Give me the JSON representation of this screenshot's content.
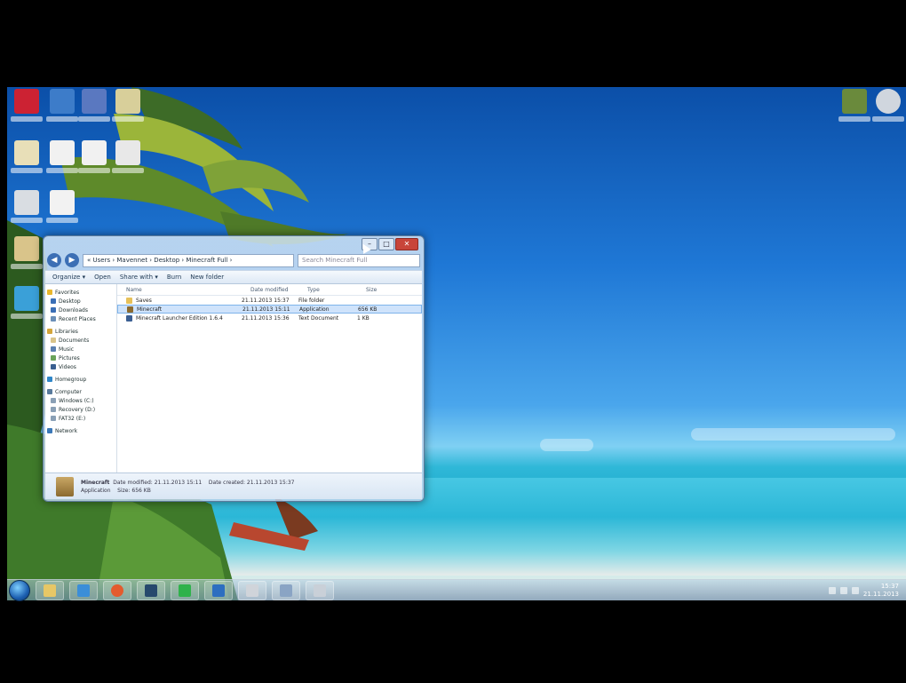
{
  "explorer": {
    "address": "« Users › Mavennet › Desktop › Minecraft Full ›",
    "search_placeholder": "Search Minecraft Full",
    "toolbar": [
      "Organize ▾",
      "Open",
      "Share with ▾",
      "Burn",
      "New folder"
    ],
    "nav": [
      {
        "label": "Favorites",
        "top": true,
        "icon": "star-icon",
        "color": "#e9b72c"
      },
      {
        "label": "Desktop",
        "top": false,
        "icon": "desktop-icon",
        "color": "#3a6fb6"
      },
      {
        "label": "Downloads",
        "top": false,
        "icon": "downloads-icon",
        "color": "#3a6fb6"
      },
      {
        "label": "Recent Places",
        "top": false,
        "icon": "recent-places-icon",
        "color": "#6b8fb8"
      },
      {
        "label": "Libraries",
        "top": true,
        "icon": "libraries-icon",
        "color": "#d4a63a"
      },
      {
        "label": "Documents",
        "top": false,
        "icon": "documents-icon",
        "color": "#d9c48a"
      },
      {
        "label": "Music",
        "top": false,
        "icon": "music-icon",
        "color": "#5a7fb0"
      },
      {
        "label": "Pictures",
        "top": false,
        "icon": "pictures-icon",
        "color": "#6aa35a"
      },
      {
        "label": "Videos",
        "top": false,
        "icon": "videos-icon",
        "color": "#3a5f90"
      },
      {
        "label": "Homegroup",
        "top": true,
        "icon": "homegroup-icon",
        "color": "#2f86c8"
      },
      {
        "label": "Computer",
        "top": true,
        "icon": "computer-icon",
        "color": "#587a9c"
      },
      {
        "label": "Windows (C:)",
        "top": false,
        "icon": "drive-icon",
        "color": "#8aa0b6"
      },
      {
        "label": "Recovery (D:)",
        "top": false,
        "icon": "drive-icon",
        "color": "#8aa0b6"
      },
      {
        "label": "FAT32 (E:)",
        "top": false,
        "icon": "drive-icon",
        "color": "#8aa0b6"
      },
      {
        "label": "Network",
        "top": true,
        "icon": "network-icon",
        "color": "#3b78b8"
      }
    ],
    "columns": [
      "Name",
      "Date modified",
      "Type",
      "Size"
    ],
    "files": [
      {
        "name": "Saves",
        "date": "21.11.2013 15:37",
        "type": "File folder",
        "size": "",
        "icon": "folder-icon",
        "color": "#e6c15a",
        "selected": false
      },
      {
        "name": "Minecraft",
        "date": "21.11.2013 15:11",
        "type": "Application",
        "size": "656 KB",
        "icon": "minecraft-icon",
        "color": "#8b6a2f",
        "selected": true
      },
      {
        "name": "Minecraft Launcher Edition 1.6.4",
        "date": "21.11.2013 15:36",
        "type": "Text Document",
        "size": "1 KB",
        "icon": "text-file-icon",
        "color": "#3b5f93",
        "selected": false
      }
    ],
    "details": {
      "name": "Minecraft",
      "line1": "Date modified: 21.11.2013 15:11",
      "kind": "Application",
      "size": "Size: 656 KB",
      "created": "Date created: 21.11.2013 15:37"
    }
  },
  "taskbar": {
    "tray_time": "15:37",
    "tray_date": "21.11.2013"
  }
}
